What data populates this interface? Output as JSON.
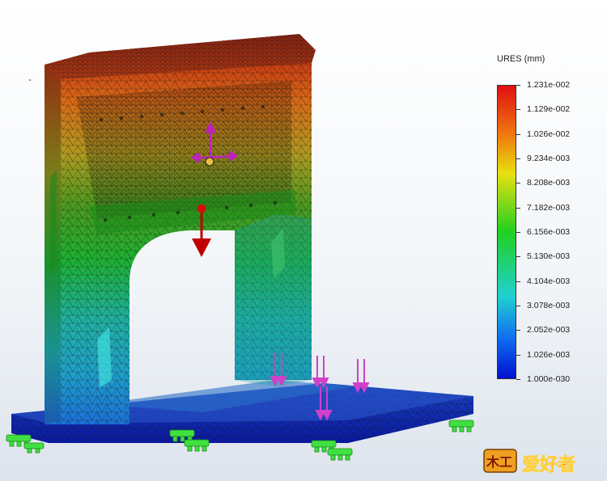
{
  "legend": {
    "title": "URES (mm)",
    "ticks": [
      "1.231e-002",
      "1.129e-002",
      "1.026e-002",
      "9.234e-003",
      "8.208e-003",
      "7.182e-003",
      "6.156e-003",
      "5.130e-003",
      "4.104e-003",
      "3.078e-003",
      "2.052e-003",
      "1.026e-003",
      "1.000e-030"
    ],
    "colors": {
      "max": "#e01010",
      "high": "#f07a10",
      "upper": "#e8e010",
      "mid": "#20d020",
      "lower": "#20d0d0",
      "low": "#1070f0",
      "min": "#0010d0"
    }
  },
  "viewport": {
    "mark": "-"
  },
  "logo": {
    "text": "爱好者",
    "glyph": "木工"
  }
}
